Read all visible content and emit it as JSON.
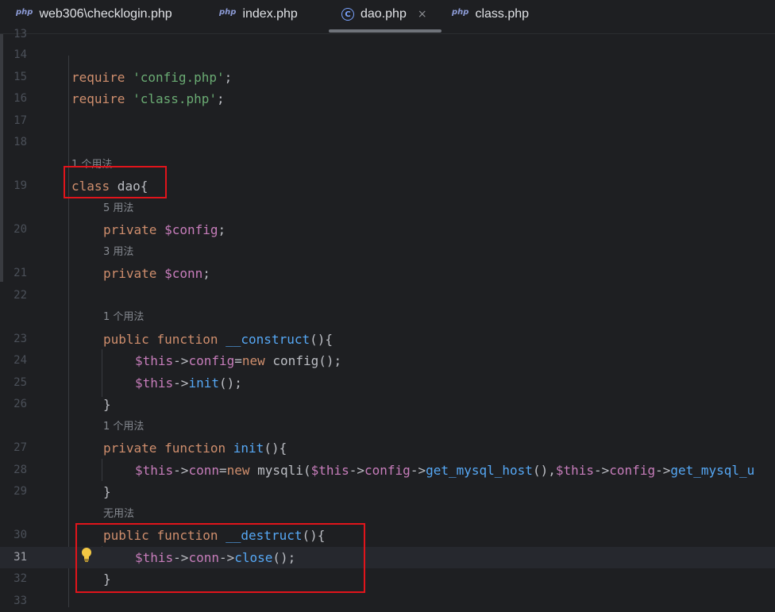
{
  "tabs": [
    {
      "icon": "php-icon",
      "icon_text": "php",
      "label": "web306\\checklogin.php"
    },
    {
      "icon": "php-icon",
      "icon_text": "php",
      "label": "index.php"
    },
    {
      "icon": "class-icon",
      "icon_text": "C",
      "label": "dao.php",
      "active": true,
      "close": "×"
    },
    {
      "icon": "php-icon",
      "icon_text": "php",
      "label": "class.php"
    }
  ],
  "lines": {
    "13": "13",
    "14": "14",
    "15": "15",
    "16": "16",
    "17": "17",
    "18": "18",
    "19": "19",
    "20": "20",
    "21": "21",
    "22": "22",
    "23": "23",
    "24": "24",
    "25": "25",
    "26": "26",
    "27": "27",
    "28": "28",
    "29": "29",
    "30": "30",
    "31": "31",
    "32": "32",
    "33": "33"
  },
  "hints": {
    "class_usages": "1 个用法",
    "config_usages": "5 用法",
    "conn_usages": "3 用法",
    "construct_usages": "1 个用法",
    "init_usages": "1 个用法",
    "destruct_usages": "无用法"
  },
  "code": {
    "l15_kw": "require",
    "l15_str": "'config.php'",
    "l15_end": ";",
    "l16_kw": "require",
    "l16_str": "'class.php'",
    "l16_end": ";",
    "l19_kw": "class",
    "l19_rest": " dao{",
    "l20_kw": "private",
    "l20_var": "$config",
    "l20_end": ";",
    "l21_kw": "private",
    "l21_var": "$conn",
    "l21_end": ";",
    "l23_kw1": "public",
    "l23_kw2": "function",
    "l23_fn": "__construct",
    "l23_end": "(){",
    "l24_this": "$this",
    "l24_arrow": "->",
    "l24_prop": "config",
    "l24_eq": "=",
    "l24_new": "new",
    "l24_rest": " config();",
    "l25_this": "$this",
    "l25_arrow": "->",
    "l25_fn": "init",
    "l25_end": "();",
    "l26": "}",
    "l27_kw1": "private",
    "l27_kw2": "function",
    "l27_fn": "init",
    "l27_end": "(){",
    "l28_this1": "$this",
    "l28_a1": "->",
    "l28_p1": "conn",
    "l28_eq": "=",
    "l28_new": "new",
    "l28_cls": " mysqli(",
    "l28_this2": "$this",
    "l28_a2": "->",
    "l28_p2": "config",
    "l28_a3": "->",
    "l28_f1": "get_mysql_host",
    "l28_mid": "(),",
    "l28_this3": "$this",
    "l28_a4": "->",
    "l28_p3": "config",
    "l28_a5": "->",
    "l28_f2": "get_mysql_u",
    "l29": "}",
    "l30_kw1": "public",
    "l30_kw2": "function",
    "l30_fn": "__destruct",
    "l30_end": "(){",
    "l31_this": "$this",
    "l31_a1": "->",
    "l31_prop": "conn",
    "l31_a2": "->",
    "l31_fn": "close",
    "l31_end": "();",
    "l32": "}"
  },
  "colors": {
    "keyword": "#cf8e6d",
    "string": "#6aab73",
    "variable": "#c77dbb",
    "function": "#56a8f5",
    "text": "#bcbec4",
    "annotation_box": "#e1141b",
    "bulb": "#f2c744"
  }
}
